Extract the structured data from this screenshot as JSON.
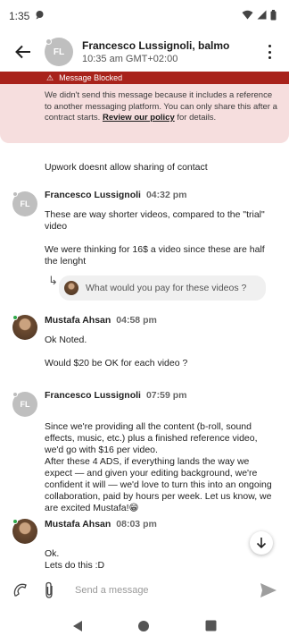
{
  "status_bar": {
    "time": "1:35"
  },
  "header": {
    "avatar_initials": "FL",
    "name": "Francesco Lussignoli, balmo",
    "local_time": "10:35 am GMT+02:00"
  },
  "blocked_banner": {
    "title": "Message Blocked",
    "text": "We didn't send this message because it includes a reference to another messaging platform. You can only share this after a contract starts.",
    "link": "Review our policy",
    "text_after": " for details."
  },
  "messages": [
    {
      "body": [
        "Upwork doesnt allow sharing of contact"
      ]
    },
    {
      "avatar": "FL",
      "sender": "Francesco Lussignoli",
      "time": "04:32 pm",
      "body": [
        "These are way shorter videos, compared to the \"trial\" video",
        "We were thinking for 16$ a video since these are half the lenght"
      ],
      "quoted": "What would you pay for these videos ?"
    },
    {
      "sender": "Mustafa Ahsan",
      "time": "04:58 pm",
      "body": [
        "Ok Noted.",
        "Would $20 be OK for each video ?"
      ]
    },
    {
      "avatar": "FL",
      "sender": "Francesco Lussignoli",
      "time": "07:59 pm",
      "body": [
        "Since we're providing all the content (b-roll, sound effects, music, etc.) plus a finished reference video, we'd go with $16 per video.\nAfter these 4 ADS, if everything lands the way we expect — and given your editing background, we're confident it will — we'd love to turn this into an ongoing collaboration, paid by hours per week. Let us know, we are excited Mustafa!😁"
      ]
    },
    {
      "sender": "Mustafa Ahsan",
      "time": "08:03 pm",
      "body": [
        "Ok.\nLets do this :D"
      ]
    }
  ],
  "composer": {
    "placeholder": "Send a message"
  },
  "colors": {
    "blocked_bar": "#a8221b",
    "blocked_bg": "#f6dede",
    "online": "#2ea84a"
  }
}
